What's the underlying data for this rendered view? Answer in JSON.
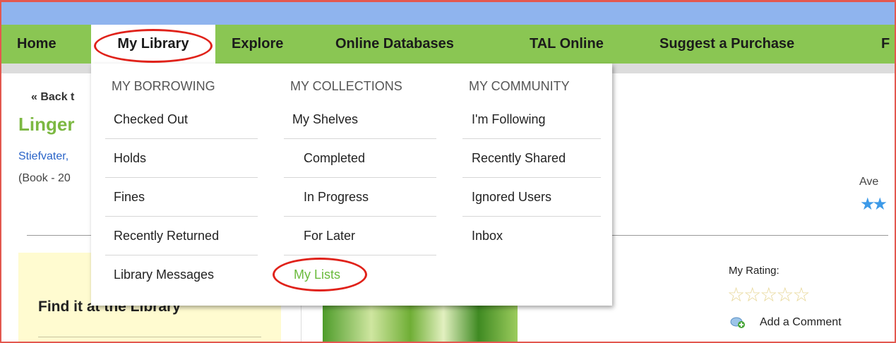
{
  "nav": {
    "items": [
      "Home",
      "My Library",
      "Explore",
      "Online Databases",
      "TAL Online",
      "Suggest a Purchase",
      "F"
    ]
  },
  "page": {
    "back": "« Back t",
    "title": "Linger",
    "author": "Stiefvater, ",
    "format": "(Book - 20",
    "average": "Ave",
    "find_title": "Find it at the Library",
    "my_rating": "My Rating:",
    "add_comment": "Add a Comment"
  },
  "dropdown": {
    "borrowing": {
      "heading": "MY BORROWING",
      "items": [
        "Checked Out",
        "Holds",
        "Fines",
        "Recently Returned",
        "Library Messages"
      ]
    },
    "collections": {
      "heading": "MY COLLECTIONS",
      "items": [
        "My Shelves",
        "Completed",
        "In Progress",
        "For Later",
        "My Lists"
      ]
    },
    "community": {
      "heading": "MY COMMUNITY",
      "items": [
        "I'm Following",
        "Recently Shared",
        "Ignored Users",
        "Inbox"
      ]
    }
  },
  "icons": {
    "rating_stars": "☆☆☆☆☆",
    "average_stars": "★★"
  },
  "colors": {
    "nav_green": "#8ac653",
    "title_green": "#7cb842",
    "highlight_red": "#e0221a",
    "link_blue": "#2a64c8"
  }
}
